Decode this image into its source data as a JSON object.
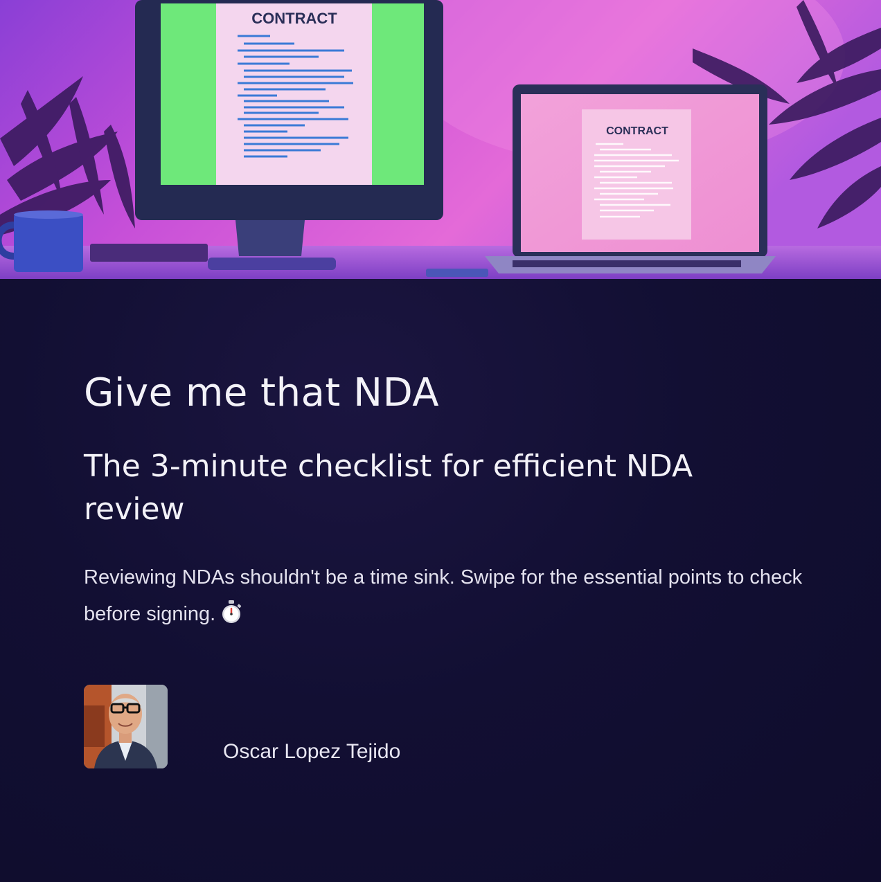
{
  "hero": {
    "monitor_doc_title": "CONTRACT",
    "laptop_doc_title": "CONTRACT"
  },
  "slide": {
    "title": "Give me that NDA",
    "subtitle": "The 3-minute checklist for efficient NDA review",
    "description": "Reviewing NDAs shouldn't be a time sink. Swipe for the essential points to check before signing.",
    "description_icon": "stopwatch-icon",
    "author_name": "Oscar Lopez Tejido"
  },
  "colors": {
    "background": "#100d2e",
    "hero_pink": "#e05ad6",
    "hero_purple": "#7a3fd8",
    "screen_green": "#6ee87a",
    "text": "#f3f2f8"
  }
}
